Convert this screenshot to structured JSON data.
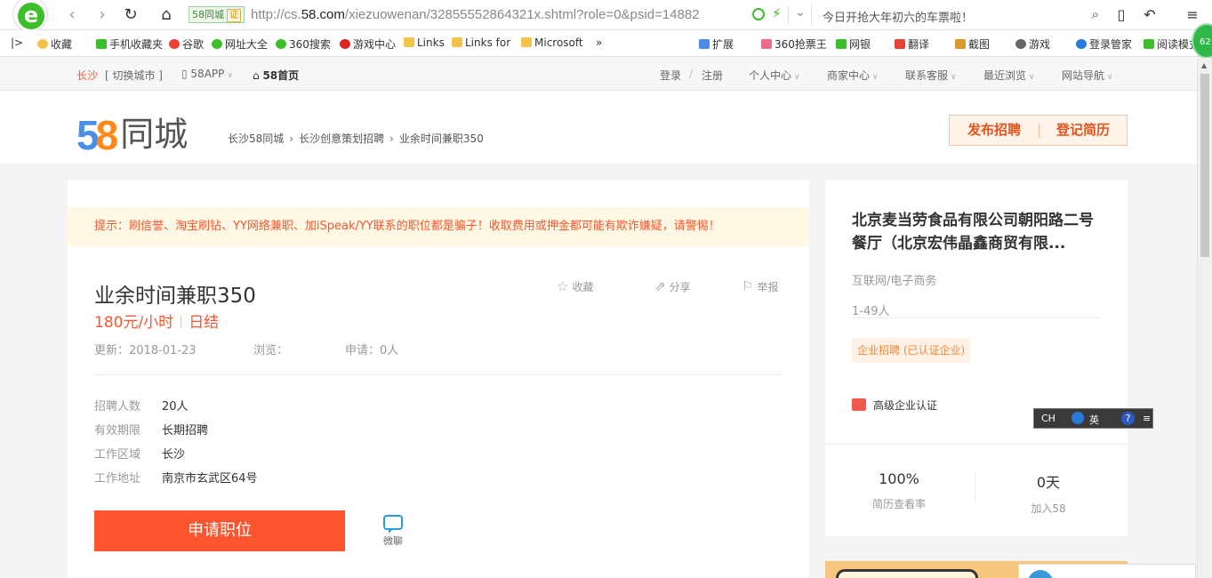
{
  "browser": {
    "site_badge": "58同城",
    "site_badge_cert": "证",
    "url_prefix": "http://cs.",
    "url_domain": "58.com",
    "url_suffix": "/xiezuowenan/32855552864321x.shtml?role=0&psid=14882",
    "search_text": "今日开抢大年初六的车票啦！",
    "bookmarks": [
      "收藏",
      "手机收藏夹",
      "谷歌",
      "网址大全",
      "360搜索",
      "游戏中心",
      "Links",
      "Links for",
      "Microsoft",
      "»",
      "扩展",
      "360抢票王",
      "网银",
      "翻译",
      "截图",
      "游戏",
      "登录管家",
      "阅读模式"
    ],
    "ext_badge": "62"
  },
  "topbar": {
    "city": "长沙",
    "switch_city": "[ 切换城市 ]",
    "app": "58APP",
    "home": "58首页",
    "login": "登录",
    "slash": "/",
    "register": "注册",
    "personal": "个人中心",
    "merchant": "商家中心",
    "service": "联系客服",
    "recent": "最近浏览",
    "site_nav": "网站导航"
  },
  "header": {
    "logo_5": "5",
    "logo_8": "8",
    "logo_text": "同城",
    "breadcrumb": [
      "长沙58同城",
      "长沙创意策划招聘",
      "业余时间兼职350"
    ],
    "post_job": "发布招聘",
    "post_resume": "登记简历"
  },
  "job": {
    "warning": "提示：刷信誉、淘宝刷钻、YY网络兼职、加iSpeak/YY联系的职位都是骗子！收取费用或押金都可能有欺诈嫌疑，请警惕！",
    "title": "业余时间兼职350",
    "salary": "180元/小时",
    "pay_type": "日结",
    "collect": "收藏",
    "share": "分享",
    "report": "举报",
    "updated": "更新：2018-01-23",
    "views": "浏览：",
    "applied": "申请：0人",
    "info": [
      {
        "k": "招聘人数",
        "v": "20人"
      },
      {
        "k": "有效期限",
        "v": "长期招聘"
      },
      {
        "k": "工作区域",
        "v": "长沙"
      },
      {
        "k": "工作地址",
        "v": "南京市玄武区64号"
      }
    ],
    "apply": "申请职位",
    "wechat": "微聊"
  },
  "company": {
    "name": "北京麦当劳食品有限公司朝阳路二号餐厅（北京宏伟晶鑫商贸有限...",
    "industry": "互联网/电子商务",
    "size": "1-49人",
    "tag": "企业招聘 (已认证企业)",
    "cert": "高级企业认证",
    "stat1_num": "100%",
    "stat1_label": "简历查看率",
    "stat2_num": "0天",
    "stat2_label": "加入58"
  },
  "ime": {
    "ch": "CH",
    "lang": "英",
    "help": "?"
  },
  "colors": {
    "accent": "#ff552e",
    "logo_blue": "#4a8ee8",
    "logo_orange": "#ff8a1a"
  }
}
